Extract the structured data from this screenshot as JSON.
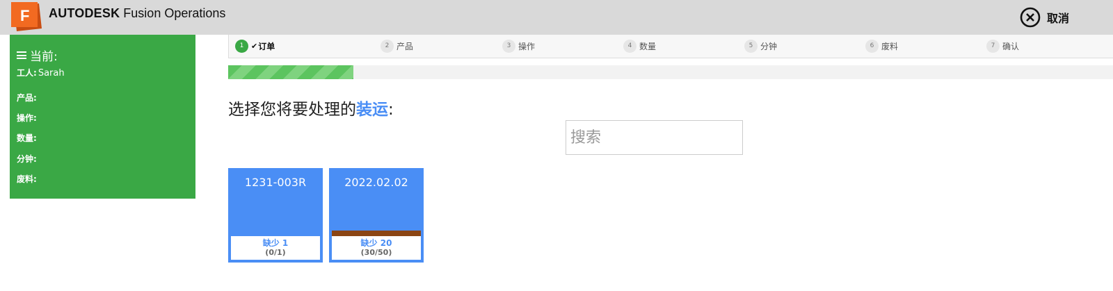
{
  "header": {
    "brand_bold": "AUTODESK",
    "brand_rest": "Fusion Operations",
    "cancel_label": "取消",
    "logo_letter": "F"
  },
  "sidebar": {
    "title": "当前:",
    "rows": [
      {
        "label": "工人:",
        "value": "Sarah"
      },
      {
        "label": "产品:",
        "value": ""
      },
      {
        "label": "操作:",
        "value": ""
      },
      {
        "label": "数量:",
        "value": ""
      },
      {
        "label": "分钟:",
        "value": ""
      },
      {
        "label": "废料:",
        "value": ""
      }
    ]
  },
  "steps": [
    {
      "num": "1",
      "label": "订单",
      "active": true
    },
    {
      "num": "2",
      "label": "产品",
      "active": false
    },
    {
      "num": "3",
      "label": "操作",
      "active": false
    },
    {
      "num": "4",
      "label": "数量",
      "active": false
    },
    {
      "num": "5",
      "label": "分钟",
      "active": false
    },
    {
      "num": "6",
      "label": "废料",
      "active": false
    },
    {
      "num": "7",
      "label": "确认",
      "active": false
    }
  ],
  "progress_fraction": 0.1415,
  "prompt": {
    "prefix": "选择您将要处理的",
    "highlight": "装运",
    "suffix": ":"
  },
  "search": {
    "placeholder": "搜索",
    "value": ""
  },
  "cards": [
    {
      "title": "1231-003R",
      "shortage": "缺少 1",
      "count": "(0/1)",
      "has_bar": false
    },
    {
      "title": "2022.02.02",
      "shortage": "缺少 20",
      "count": "(30/50)",
      "has_bar": true
    }
  ],
  "colors": {
    "header_bg": "#d9d9d9",
    "sidebar_green": "#3aa845",
    "accent_blue": "#4a8ef5",
    "logo_orange": "#f26a21",
    "bar_brown": "#8b4513"
  },
  "icons": {
    "logo": "autodesk-fusion-logo",
    "cancel": "close-circle-icon",
    "menu": "hamburger-menu-icon",
    "check": "check-icon"
  }
}
